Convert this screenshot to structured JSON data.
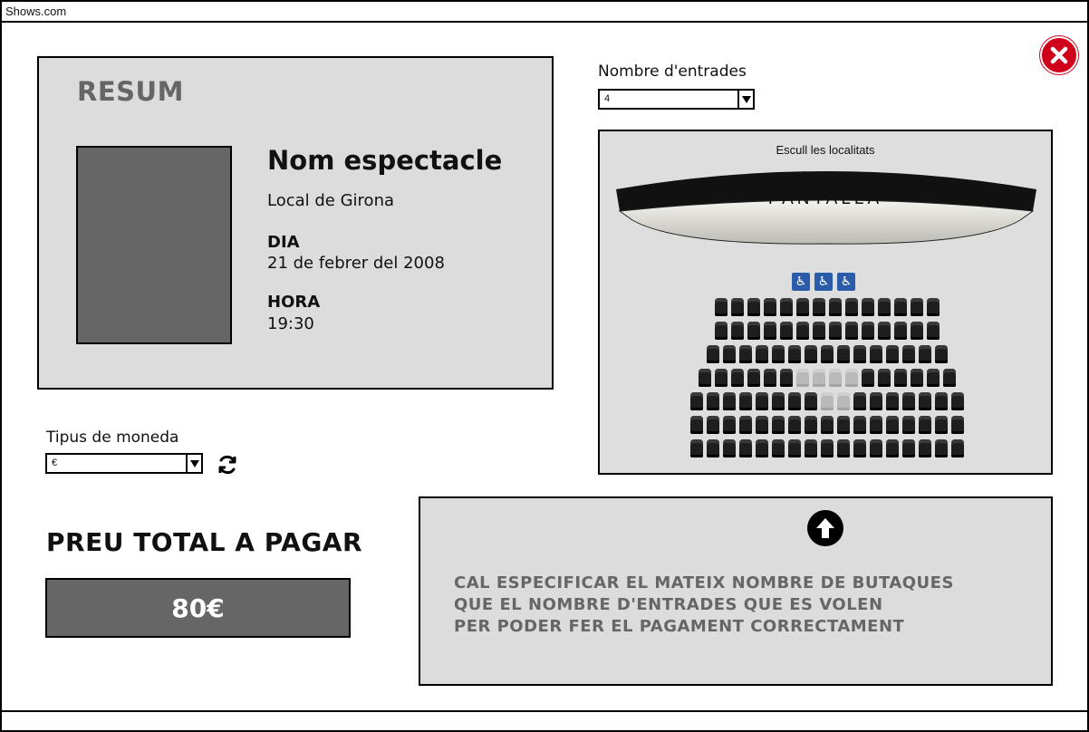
{
  "window": {
    "title": "Shows.com"
  },
  "summary": {
    "heading": "RESUM",
    "show_name": "Nom espectacle",
    "venue": "Local de Girona",
    "day_label": "DIA",
    "day_value": "21 de febrer del 2008",
    "time_label": "HORA",
    "time_value": "19:30"
  },
  "currency": {
    "label": "Tipus de moneda",
    "selected": "€"
  },
  "total": {
    "label": "PREU TOTAL A PAGAR",
    "value": "80€"
  },
  "tickets": {
    "label": "Nombre d'entrades",
    "selected": "4"
  },
  "seatmap": {
    "title": "Escull les localitats",
    "screen_label": "PANTALLA",
    "rows": [
      14,
      14,
      15,
      16,
      17,
      17,
      17
    ],
    "selected_seats": [
      [
        3,
        6
      ],
      [
        3,
        7
      ],
      [
        3,
        8
      ],
      [
        3,
        9
      ],
      [
        4,
        8
      ],
      [
        4,
        9
      ]
    ]
  },
  "notice": {
    "lines": [
      "CAL ESPECIFICAR EL MATEIX NOMBRE DE BUTAQUES",
      "QUE EL NOMBRE D'ENTRADES QUE ES VOLEN",
      "PER PODER FER EL PAGAMENT CORRECTAMENT"
    ]
  },
  "icons": {
    "close": "close-icon",
    "refresh": "refresh-icon",
    "arrow_up": "arrow-up-icon",
    "dropdown": "chevron-down-icon",
    "wheelchair": "wheelchair-icon"
  },
  "colors": {
    "close": "#d0021b",
    "panel": "#dcdcdc",
    "dark": "#666666",
    "wheelchair": "#2a5caa"
  }
}
